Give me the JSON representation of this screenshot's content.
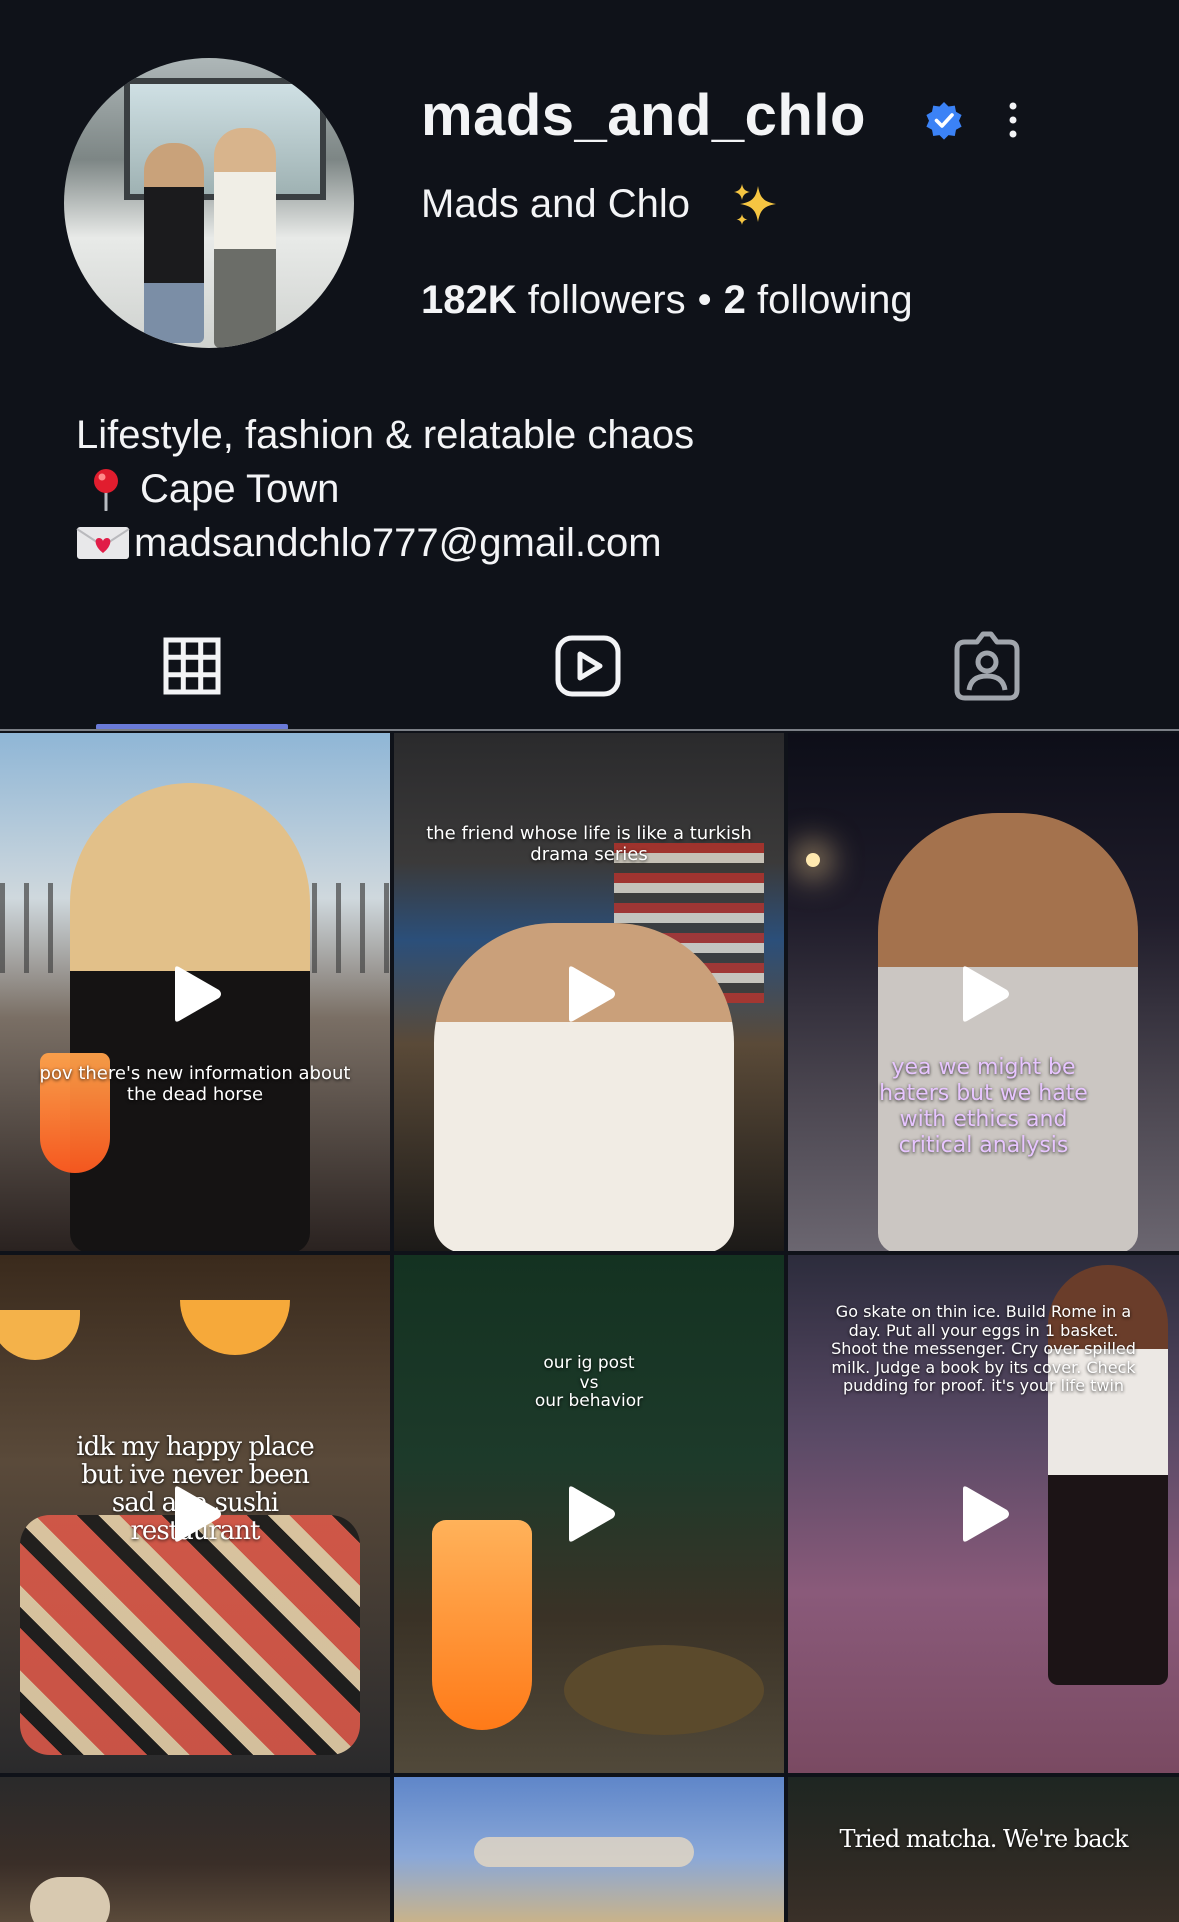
{
  "profile": {
    "username": "mads_and_chlo",
    "display_name": "Mads and Chlo",
    "followers_count": "182K",
    "followers_label": "followers",
    "separator": "•",
    "following_count": "2",
    "following_label": "following",
    "verified": true
  },
  "bio": {
    "line1": "Lifestyle, fashion & relatable chaos",
    "location": "Cape Town",
    "email": "madsandchlo777@gmail.com"
  },
  "tabs": [
    {
      "name": "posts-grid",
      "icon": "grid-icon",
      "active": true
    },
    {
      "name": "reels",
      "icon": "reels-icon",
      "active": false
    },
    {
      "name": "tagged",
      "icon": "tagged-icon",
      "active": false
    }
  ],
  "posts": [
    {
      "caption": "pov there's new information about the dead horse",
      "type": "video"
    },
    {
      "caption": "the friend whose life is like a turkish drama series",
      "type": "video"
    },
    {
      "caption": "yea we might be haters but we hate with ethics and critical analysis",
      "type": "video"
    },
    {
      "caption": "idk my happy place but ive never been sad at a sushi restaurant",
      "type": "video"
    },
    {
      "caption_top": "our ig post",
      "caption_mid": "vs",
      "caption_bottom": "our behavior",
      "type": "video"
    },
    {
      "caption": "Go skate on thin ice. Build Rome in a day. Put all your eggs in 1 basket. Shoot the messenger. Cry over spilled milk. Judge a book by its cover. Check pudding for proof. it's your life twin",
      "type": "video"
    },
    {
      "caption": "",
      "type": "image"
    },
    {
      "caption": "",
      "type": "image"
    },
    {
      "caption": "Tried matcha. We're back",
      "type": "image"
    }
  ],
  "colors": {
    "background": "#0f1219",
    "accent_underline": "#6a7ad8",
    "verified_badge": "#3b82f6"
  }
}
